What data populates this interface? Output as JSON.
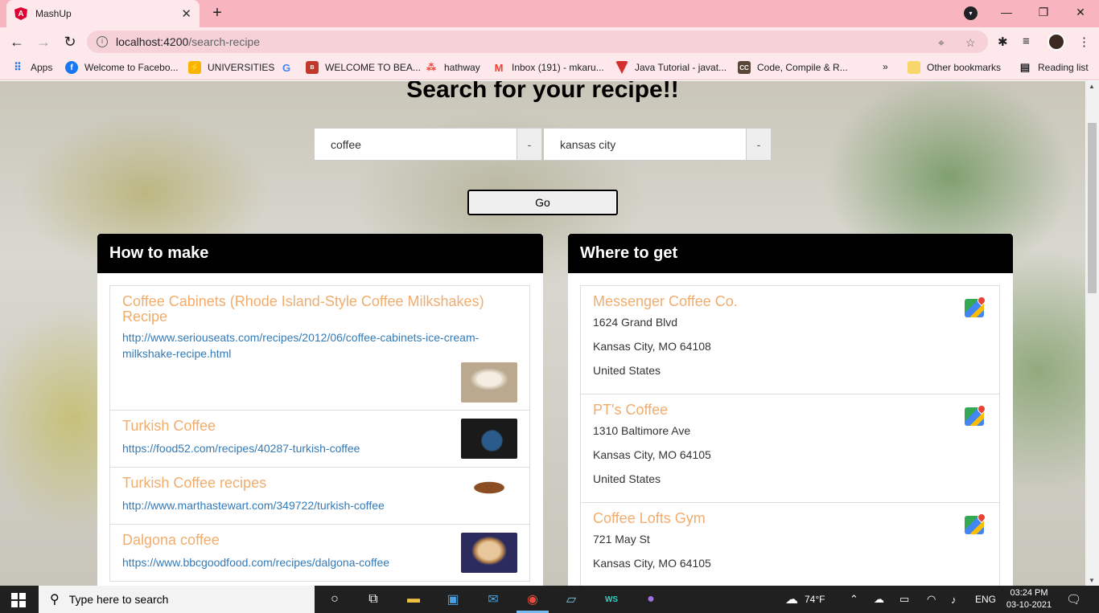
{
  "browser": {
    "tab_title": "MashUp",
    "tab_close": "✕",
    "new_tab": "+",
    "url_host": "localhost:4200",
    "url_path": "/search-recipe",
    "bookmarks": [
      {
        "label": "Apps",
        "icon": "apps-grid-icon"
      },
      {
        "label": "Welcome to Facebo...",
        "icon": "facebook-icon"
      },
      {
        "label": "UNIVERSITIES",
        "icon": "universities-icon"
      },
      {
        "label": "",
        "icon": "google-icon"
      },
      {
        "label": "WELCOME TO BEA...",
        "icon": "bea-icon"
      },
      {
        "label": "hathway",
        "icon": "hathway-icon"
      },
      {
        "label": "Inbox (191) - mkaru...",
        "icon": "gmail-icon"
      },
      {
        "label": "Java Tutorial - javat...",
        "icon": "javatpoint-icon"
      },
      {
        "label": "Code, Compile & R...",
        "icon": "codechef-icon"
      }
    ],
    "more_bookmarks": "»",
    "other_bookmarks": "Other bookmarks",
    "reading_list": "Reading list"
  },
  "page": {
    "heading": "Search for your recipe!!",
    "search_query": "coffee",
    "location_query": "kansas city",
    "addon_label": "-",
    "go_label": "Go",
    "recipes_header": "How to make",
    "places_header": "Where to get",
    "recipes": [
      {
        "title": "Coffee Cabinets (Rhode Island-Style Coffee Milkshakes) Recipe",
        "url": "http://www.seriouseats.com/recipes/2012/06/coffee-cabinets-ice-cream-milkshake-recipe.html"
      },
      {
        "title": "Turkish Coffee",
        "url": "https://food52.com/recipes/40287-turkish-coffee"
      },
      {
        "title": "Turkish Coffee recipes",
        "url": "http://www.marthastewart.com/349722/turkish-coffee"
      },
      {
        "title": "Dalgona coffee",
        "url": "https://www.bbcgoodfood.com/recipes/dalgona-coffee"
      }
    ],
    "places": [
      {
        "name": "Messenger Coffee Co.",
        "street": "1624 Grand Blvd",
        "city": "Kansas City, MO 64108",
        "country": "United States"
      },
      {
        "name": "PT's Coffee",
        "street": "1310 Baltimore Ave",
        "city": "Kansas City, MO 64105",
        "country": "United States"
      },
      {
        "name": "Coffee Lofts Gym",
        "street": "721 May St",
        "city": "Kansas City, MO 64105",
        "country": ""
      }
    ]
  },
  "taskbar": {
    "search_placeholder": "Type here to search",
    "weather": "74°F",
    "language": "ENG",
    "time": "03:24 PM",
    "date": "03-10-2021"
  },
  "colors": {
    "tab_strip": "#f8b4bf",
    "toolbar": "#fde8ec",
    "link_title": "#f0ad6e",
    "link_url": "#337ab7"
  }
}
